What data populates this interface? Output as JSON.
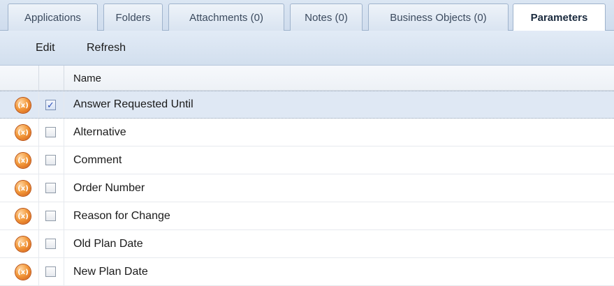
{
  "tabs": [
    {
      "label": "Applications",
      "active": false
    },
    {
      "label": "Folders",
      "active": false
    },
    {
      "label": "Attachments (0)",
      "active": false
    },
    {
      "label": "Notes (0)",
      "active": false
    },
    {
      "label": "Business Objects (0)",
      "active": false
    },
    {
      "label": "Parameters",
      "active": true
    }
  ],
  "toolbar": {
    "edit_label": "Edit",
    "refresh_label": "Refresh"
  },
  "grid": {
    "header": {
      "name": "Name"
    },
    "rows": [
      {
        "name": "Answer Requested Until",
        "checked": true,
        "selected": true,
        "icon": "fx-parameter-icon"
      },
      {
        "name": "Alternative",
        "checked": false,
        "selected": false,
        "icon": "fx-parameter-icon"
      },
      {
        "name": "Comment",
        "checked": false,
        "selected": false,
        "icon": "fx-parameter-icon"
      },
      {
        "name": "Order Number",
        "checked": false,
        "selected": false,
        "icon": "fx-parameter-icon"
      },
      {
        "name": "Reason for Change",
        "checked": false,
        "selected": false,
        "icon": "fx-parameter-icon"
      },
      {
        "name": "Old Plan Date",
        "checked": false,
        "selected": false,
        "icon": "fx-parameter-icon"
      },
      {
        "name": "New Plan Date",
        "checked": false,
        "selected": false,
        "icon": "fx-parameter-icon"
      }
    ]
  },
  "colors": {
    "accent": "#dfe8f4",
    "icon": "#f39a3c",
    "check": "#2b4fb8"
  }
}
